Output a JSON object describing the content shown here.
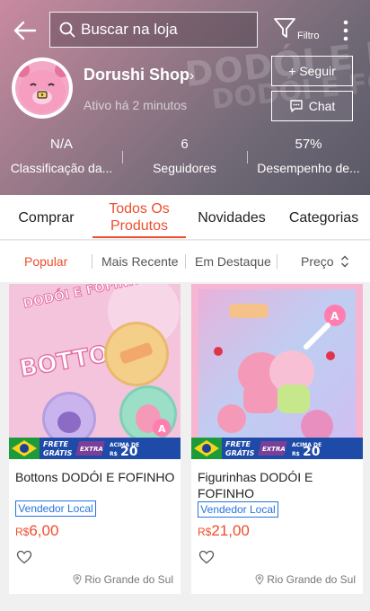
{
  "header": {
    "search_placeholder": "Buscar na loja",
    "filter_label": "Filtro",
    "banner_text_1": "DODÓI E FOFINHO",
    "banner_text_2": "DODÓI E FOFINHO"
  },
  "shop": {
    "name": "Dorushi Shop",
    "active_status": "Ativo há 2 minutos",
    "follow_label": "+ Seguir",
    "chat_label": "Chat"
  },
  "stats": [
    {
      "value": "N/A",
      "label": "Classificação da..."
    },
    {
      "value": "6",
      "label": "Seguidores"
    },
    {
      "value": "57%",
      "label": "Desempenho de..."
    }
  ],
  "tabs": [
    "Comprar",
    "Todos Os Produtos",
    "Novidades",
    "Categorias"
  ],
  "sorts": [
    "Popular",
    "Mais Recente",
    "Em Destaque",
    "Preço"
  ],
  "products": [
    {
      "title": "Bottons DODÓI E FOFINHO",
      "badge": "Vendedor Local",
      "currency": "R$",
      "price": "6,00",
      "location": "Rio Grande do Sul",
      "image_title": "DODÓI E FOFINHO",
      "image_text": "BOTTONS"
    },
    {
      "title": "Figurinhas DODÓI E FOFINHO",
      "badge": "Vendedor Local",
      "currency": "R$",
      "price": "21,00",
      "location": "Rio Grande do Sul"
    }
  ],
  "promo": {
    "line1": "FRETE",
    "line2": "GRÁTIS",
    "extra": "EXTRA",
    "above": "ACIMA DE",
    "currency": "R$",
    "amount": "20"
  },
  "colors": {
    "accent": "#ee4d2d",
    "badge_blue": "#2673dd"
  }
}
